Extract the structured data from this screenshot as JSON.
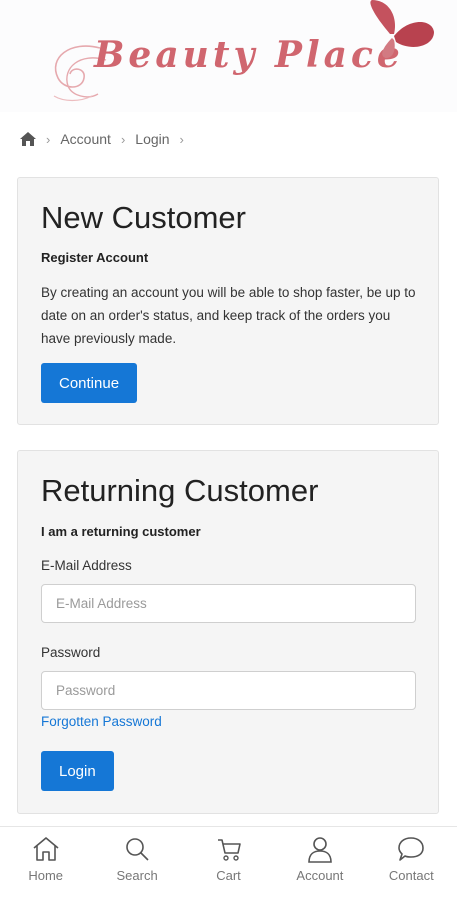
{
  "brand": {
    "logo_text": "Beauty Place"
  },
  "breadcrumb": {
    "items": [
      "Account",
      "Login"
    ]
  },
  "new_customer": {
    "title": "New Customer",
    "subtitle": "Register Account",
    "description": "By creating an account you will be able to shop faster, be up to date on an order's status, and keep track of the orders you have previously made.",
    "continue_label": "Continue"
  },
  "returning_customer": {
    "title": "Returning Customer",
    "subtitle": "I am a returning customer",
    "email_label": "E-Mail Address",
    "email_placeholder": "E-Mail Address",
    "email_value": "",
    "password_label": "Password",
    "password_placeholder": "Password",
    "password_value": "",
    "forgot_label": "Forgotten Password",
    "login_label": "Login"
  },
  "tabbar": {
    "items": [
      {
        "label": "Home",
        "icon": "home-icon"
      },
      {
        "label": "Search",
        "icon": "search-icon"
      },
      {
        "label": "Cart",
        "icon": "cart-icon"
      },
      {
        "label": "Account",
        "icon": "user-icon"
      },
      {
        "label": "Contact",
        "icon": "chat-icon"
      }
    ]
  },
  "colors": {
    "accent": "#1577d6",
    "brand": "#d0666f",
    "card_bg": "#f5f5f5"
  }
}
